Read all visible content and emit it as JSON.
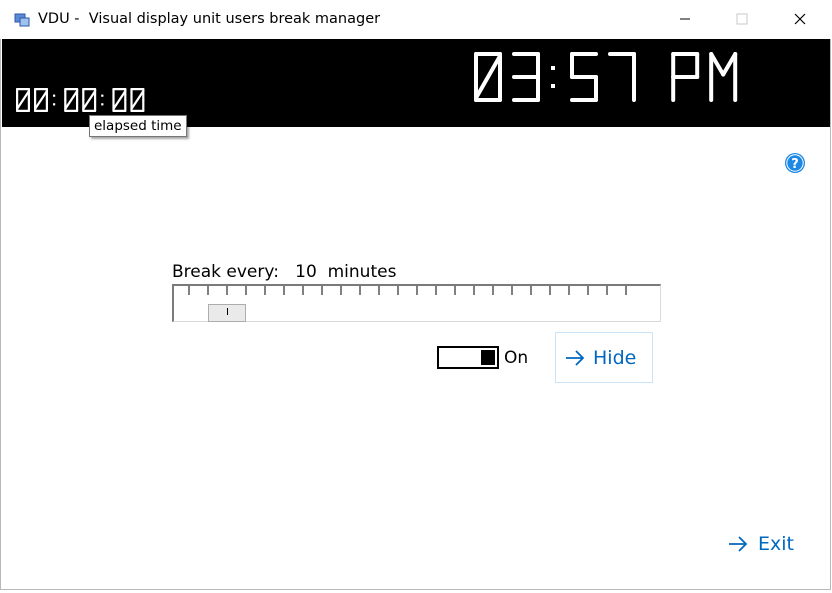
{
  "window": {
    "title": "VDU -  Visual display unit users break manager",
    "minimize_icon": "minimize-icon",
    "maximize_icon": "maximize-icon",
    "close_icon": "close-icon"
  },
  "display": {
    "elapsed": "00:00:00",
    "clock": "03:57 PM",
    "elapsed_color": "#ffffff",
    "clock_color": "#ffffff",
    "background": "#000000",
    "tooltip": "elapsed time"
  },
  "help": {
    "icon": "help-icon",
    "color": "#1e88e5"
  },
  "break": {
    "label": "Break every:",
    "value": "10",
    "unit": "minutes",
    "slider_value_fraction": 0.07
  },
  "toggle": {
    "label": "On",
    "state": "on"
  },
  "hide_button": {
    "label": "Hide",
    "icon": "arrow-right-icon"
  },
  "exit_button": {
    "label": "Exit",
    "icon": "arrow-right-icon"
  },
  "accent_color": "#0067c0"
}
